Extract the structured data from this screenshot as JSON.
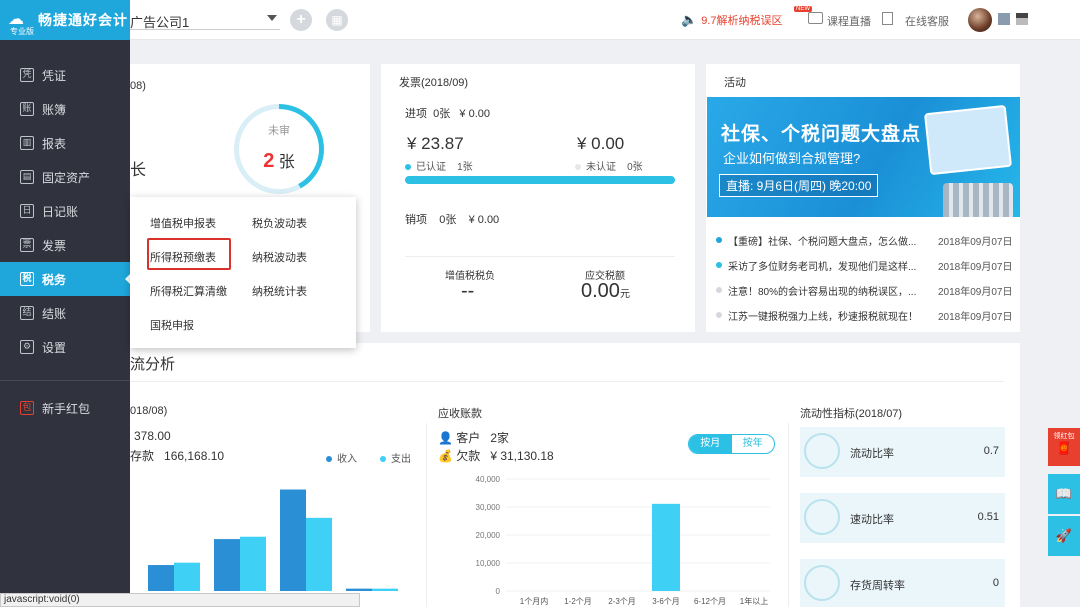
{
  "brand": {
    "name": "畅捷通好会计",
    "edition": "专业版"
  },
  "sidebar": {
    "items": [
      {
        "label": "凭证",
        "icon": "voucher-icon"
      },
      {
        "label": "账簿",
        "icon": "ledger-icon"
      },
      {
        "label": "报表",
        "icon": "chart-icon"
      },
      {
        "label": "固定资产",
        "icon": "asset-icon"
      },
      {
        "label": "日记账",
        "icon": "journal-icon"
      },
      {
        "label": "发票",
        "icon": "invoice-icon"
      },
      {
        "label": "税务",
        "icon": "tax-icon"
      },
      {
        "label": "结账",
        "icon": "close-books-icon"
      },
      {
        "label": "设置",
        "icon": "settings-icon"
      }
    ],
    "promo": "新手红包",
    "active": "税务"
  },
  "topbar": {
    "company": "广告公司1",
    "tax_link": "9.7解析纳税误区",
    "new_badge": "NEW",
    "live_course": "课程直播",
    "online_service": "在线客服"
  },
  "voucher_card": {
    "title_fragment": "08)",
    "char_fragment": "长",
    "donut_label": "未审",
    "donut_count": "2",
    "donut_unit": "张"
  },
  "invoice_card": {
    "title": "发票(2018/09)",
    "in_label": "进项",
    "in_count": "0张",
    "in_amount": "¥ 0.00",
    "certified_amount": "¥ 23.87",
    "certified_label": "已认证",
    "certified_count": "1张",
    "uncertified_amount": "¥ 0.00",
    "uncertified_label": "未认证",
    "uncertified_count": "0张",
    "out_label": "销项",
    "out_count": "0张",
    "out_amount": "¥ 0.00",
    "vat_label": "增值税税负",
    "vat_value": "--",
    "tax_due_label": "应交税额",
    "tax_due_value": "0.00",
    "tax_due_unit": "元"
  },
  "activity_card": {
    "title": "活动",
    "banner_title": "社保、个税问题大盘点",
    "banner_sub": "企业如何做到合规管理?",
    "banner_live": "直播: 9月6日(周四) 晚20:00",
    "news": [
      {
        "text": "【重磅】社保、个税问题大盘点，怎么做...",
        "date": "2018年09月07日",
        "color": "#1fa7dc"
      },
      {
        "text": "采访了多位财务老司机，发现他们是这样...",
        "date": "2018年09月07日",
        "color": "#2bc0e4"
      },
      {
        "text": "注意！80%的会计容易出现的纳税误区，...",
        "date": "2018年09月07日",
        "color": "#d5d8dc"
      },
      {
        "text": "江苏一键报税强力上线，秒速报税就现在！",
        "date": "2018年09月07日",
        "color": "#d5d8dc"
      }
    ]
  },
  "analysis": {
    "section_title": "流分析",
    "left_title_fragment": "018/08)",
    "left_value": "378.00",
    "left_debt_label": "存款",
    "left_debt_value": "166,168.10",
    "legend_income": "收入",
    "legend_expense": "支出",
    "colors": {
      "income": "#2b8fd6",
      "expense": "#3ed0f5"
    },
    "receivable_title": "应收账款",
    "customers_label": "客户",
    "customers_value": "2家",
    "owed_label": "欠款",
    "owed_value": "¥ 31,130.18",
    "toggle_month": "按月",
    "toggle_year": "按年",
    "liquidity_title": "流动性指标(2018/07)",
    "liquidity": [
      {
        "label": "流动比率",
        "value": "0.7"
      },
      {
        "label": "速动比率",
        "value": "0.51"
      },
      {
        "label": "存货周转率",
        "value": "0"
      }
    ]
  },
  "chart_data": [
    {
      "type": "bar",
      "title": "",
      "series": [
        {
          "name": "收入",
          "values": [
            22,
            44,
            86,
            2
          ]
        },
        {
          "name": "支出",
          "values": [
            24,
            46,
            62,
            2
          ]
        }
      ],
      "categories": [
        "",
        "",
        "",
        ""
      ],
      "ylim": [
        0,
        100
      ]
    },
    {
      "type": "bar",
      "title": "应收账款",
      "categories": [
        "1个月内",
        "1-2个月",
        "2-3个月",
        "3-6个月",
        "6-12个月",
        "1年以上"
      ],
      "values": [
        0,
        0,
        0,
        31130.18,
        0,
        0
      ],
      "yticks": [
        "40,000",
        "30,000",
        "20,000",
        "10,000",
        "0"
      ],
      "ylim": [
        0,
        40000
      ]
    }
  ],
  "popup_menu": {
    "items": [
      "增值税申报表",
      "税负波动表",
      "所得税预缴表",
      "纳税波动表",
      "所得税汇算清缴",
      "纳税统计表",
      "国税申报"
    ],
    "highlighted": "所得税预缴表"
  },
  "float": {
    "red_label": "领红包"
  },
  "statusbar": "javascript:void(0)"
}
